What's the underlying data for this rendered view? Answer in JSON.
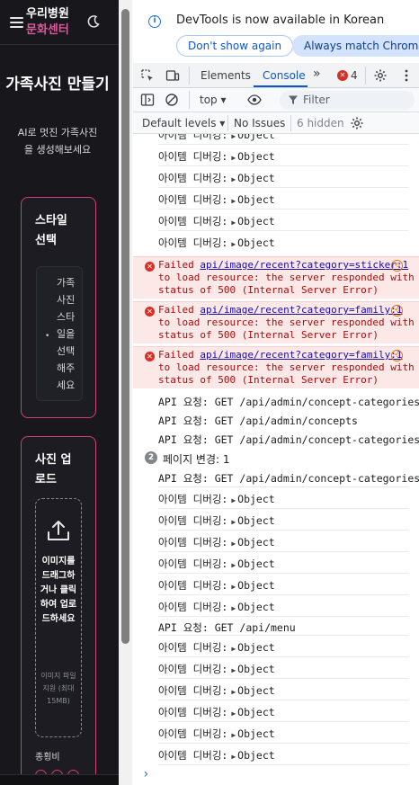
{
  "app": {
    "brand_line1": "우리병원",
    "brand_line2": "문화센터",
    "hero_title": "가족사진 만들기",
    "hero_subtitle": "AI로 멋진 가족사진을 생성해보세요",
    "style_card_title": "스타일 선택",
    "style_option_text": "가족사진 스타일을 선택해주세요",
    "upload_card_title": "사진 업로드",
    "upload_drop_text": "이미지를 드래그하거나 클릭하여 업로드하세요",
    "upload_sub_text": "이미지 파일 지원 (최대 15MB)",
    "ratio_label": "종횡비",
    "icons": {
      "menu": "hamburger-icon",
      "theme": "moon-icon",
      "upload": "upload-icon"
    },
    "accent_color": "#cf3f78"
  },
  "devtools": {
    "info_text": "DevTools is now available in Korean",
    "dont_show_label": "Don't show again",
    "always_match_label": "Always match Chrome's",
    "tabs": [
      {
        "label": "Elements"
      },
      {
        "label": "Console"
      }
    ],
    "error_count": "4",
    "context_label": "top",
    "filter_placeholder": "Filter",
    "default_levels": "Default levels",
    "no_issues": "No Issues",
    "hidden_count": "6 hidden",
    "prompt_symbol": "›"
  },
  "console": {
    "debug_prefix": "아이템 디버깅:",
    "object_label": "Object",
    "errors": [
      {
        "failed": "Failed",
        "url": "api/image/recent?category=sticker:1",
        "rest1": "to load resource: the server responded with a",
        "rest2": "status of 500 (Internal Server Error)"
      },
      {
        "failed": "Failed",
        "url": "api/image/recent?category=family:1",
        "rest1": "to load resource: the server responded with a",
        "rest2": "status of 500 (Internal Server Error)"
      },
      {
        "failed": "Failed",
        "url": "api/image/recent?category=family:1",
        "rest1": "to load resource: the server responded with a",
        "rest2": "status of 500 (Internal Server Error)"
      }
    ],
    "api_lines": [
      "API 요청: GET /api/admin/concept-categories",
      "API 요청: GET /api/admin/concepts",
      "API 요청: GET /api/admin/concept-categories",
      "API 요청: GET /api/admin/concept-categories",
      "API 요청: GET /api/menu"
    ],
    "page_change_count": "2",
    "page_change_text": "페이지 변경: 1"
  }
}
